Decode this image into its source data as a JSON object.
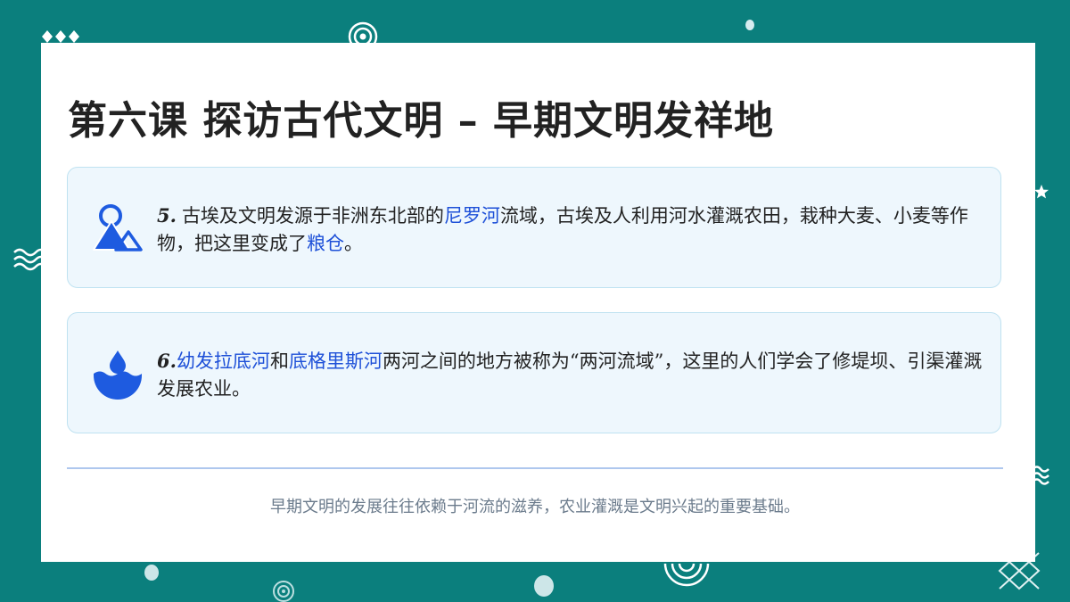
{
  "slide": {
    "title": "第六课 探访古代文明 – 早期文明发祥地"
  },
  "points": [
    {
      "icon": "mountain-sun-icon",
      "number": "5.",
      "segments": [
        {
          "text": "古埃及文明发源于非洲东北部的",
          "highlight": false
        },
        {
          "text": "尼罗河",
          "highlight": true
        },
        {
          "text": "流域，古埃及人利用河水灌溉农田，栽种大麦、小麦等作物，把这里变成了",
          "highlight": false
        },
        {
          "text": "粮仓",
          "highlight": true
        },
        {
          "text": "。",
          "highlight": false
        }
      ]
    },
    {
      "icon": "water-drop-waves-icon",
      "number": "6.",
      "segments": [
        {
          "text": "幼发拉底河",
          "highlight": true
        },
        {
          "text": "和",
          "highlight": false
        },
        {
          "text": "底格里斯河",
          "highlight": true
        },
        {
          "text": "两河之间的地方被称为“两河流域”，这里的人们学会了修堤坝、引渠灌溉发展农业。",
          "highlight": false
        }
      ]
    }
  ],
  "footer": "早期文明的发展往往依赖于河流的滋养，农业灌溉是文明兴起的重要基础。",
  "colors": {
    "background": "#0b7f7d",
    "card": "#ffffff",
    "box_fill": "#eef7fd",
    "box_border": "#bfe2f1",
    "highlight": "#1e50d8",
    "icon": "#1e5be0",
    "divider": "#aec7ee"
  },
  "decorations": [
    "diamonds-icon",
    "spiral-icon",
    "dot-icon",
    "wave-lines-icon",
    "star-icon",
    "lattice-icon"
  ]
}
